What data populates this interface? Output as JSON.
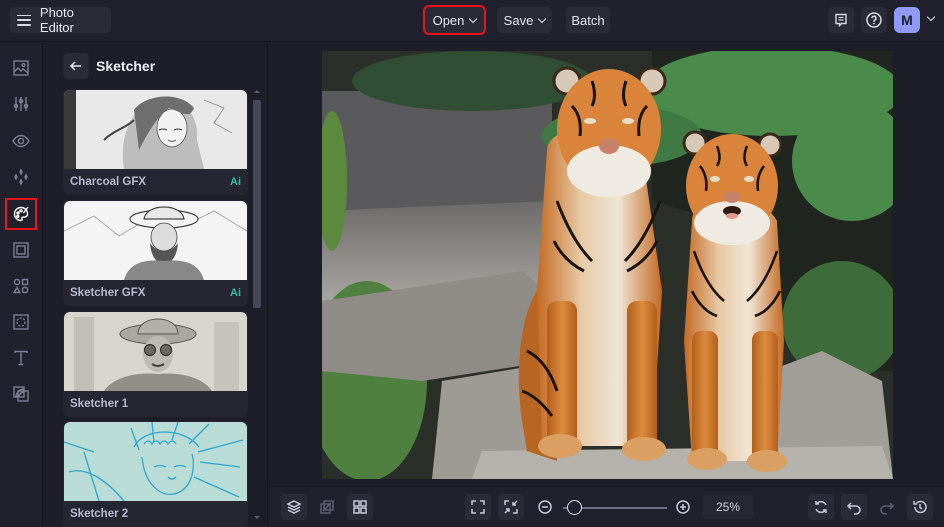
{
  "topbar": {
    "app_title": "Photo Editor",
    "menu_icon": "hamburger-menu-icon",
    "open_label": "Open",
    "save_label": "Save",
    "batch_label": "Batch",
    "feedback_icon": "feedback-icon",
    "help_icon": "help-icon",
    "avatar_initial": "M",
    "avatar_color": "#8d9bf5"
  },
  "leftrail": {
    "items": [
      {
        "name": "image",
        "icon": "image-icon"
      },
      {
        "name": "adjust",
        "icon": "sliders-icon"
      },
      {
        "name": "view",
        "icon": "eye-icon"
      },
      {
        "name": "effects",
        "icon": "sparkle-icon"
      },
      {
        "name": "artsy",
        "icon": "palette-brush-icon",
        "active": true
      },
      {
        "name": "frames",
        "icon": "frame-icon"
      },
      {
        "name": "graphics",
        "icon": "shapes-icon"
      },
      {
        "name": "overlays",
        "icon": "overlay-icon"
      },
      {
        "name": "text",
        "icon": "text-icon"
      },
      {
        "name": "textures",
        "icon": "texture-icon"
      }
    ]
  },
  "panel": {
    "title": "Sketcher",
    "back_icon": "arrow-left-icon",
    "cards": [
      {
        "name": "Charcoal GFX",
        "badge": "Ai"
      },
      {
        "name": "Sketcher GFX",
        "badge": "Ai"
      },
      {
        "name": "Sketcher 1",
        "badge": ""
      },
      {
        "name": "Sketcher 2",
        "badge": ""
      }
    ],
    "scroll_position": 0.0,
    "accent_color": "#2fbf9c"
  },
  "canvas": {
    "image_description": "Two tigers sitting on rocks in front of green foliage"
  },
  "bottombar": {
    "layers_icon": "layers-icon",
    "compare_icon": "compare-icon",
    "grid_icon": "grid-icon",
    "fit_icon": "fit-screen-icon",
    "actual_size_icon": "shrink-icon",
    "zoom_out_icon": "zoom-out-icon",
    "zoom_in_icon": "zoom-in-icon",
    "zoom_value": "25%",
    "zoom_fraction": 0.05,
    "reset_icon": "reset-icon",
    "undo_icon": "undo-icon",
    "redo_icon": "redo-icon",
    "history_icon": "history-icon"
  },
  "colors": {
    "highlight": "#e8141c",
    "background": "#1d1e28",
    "bar": "#20212c"
  }
}
